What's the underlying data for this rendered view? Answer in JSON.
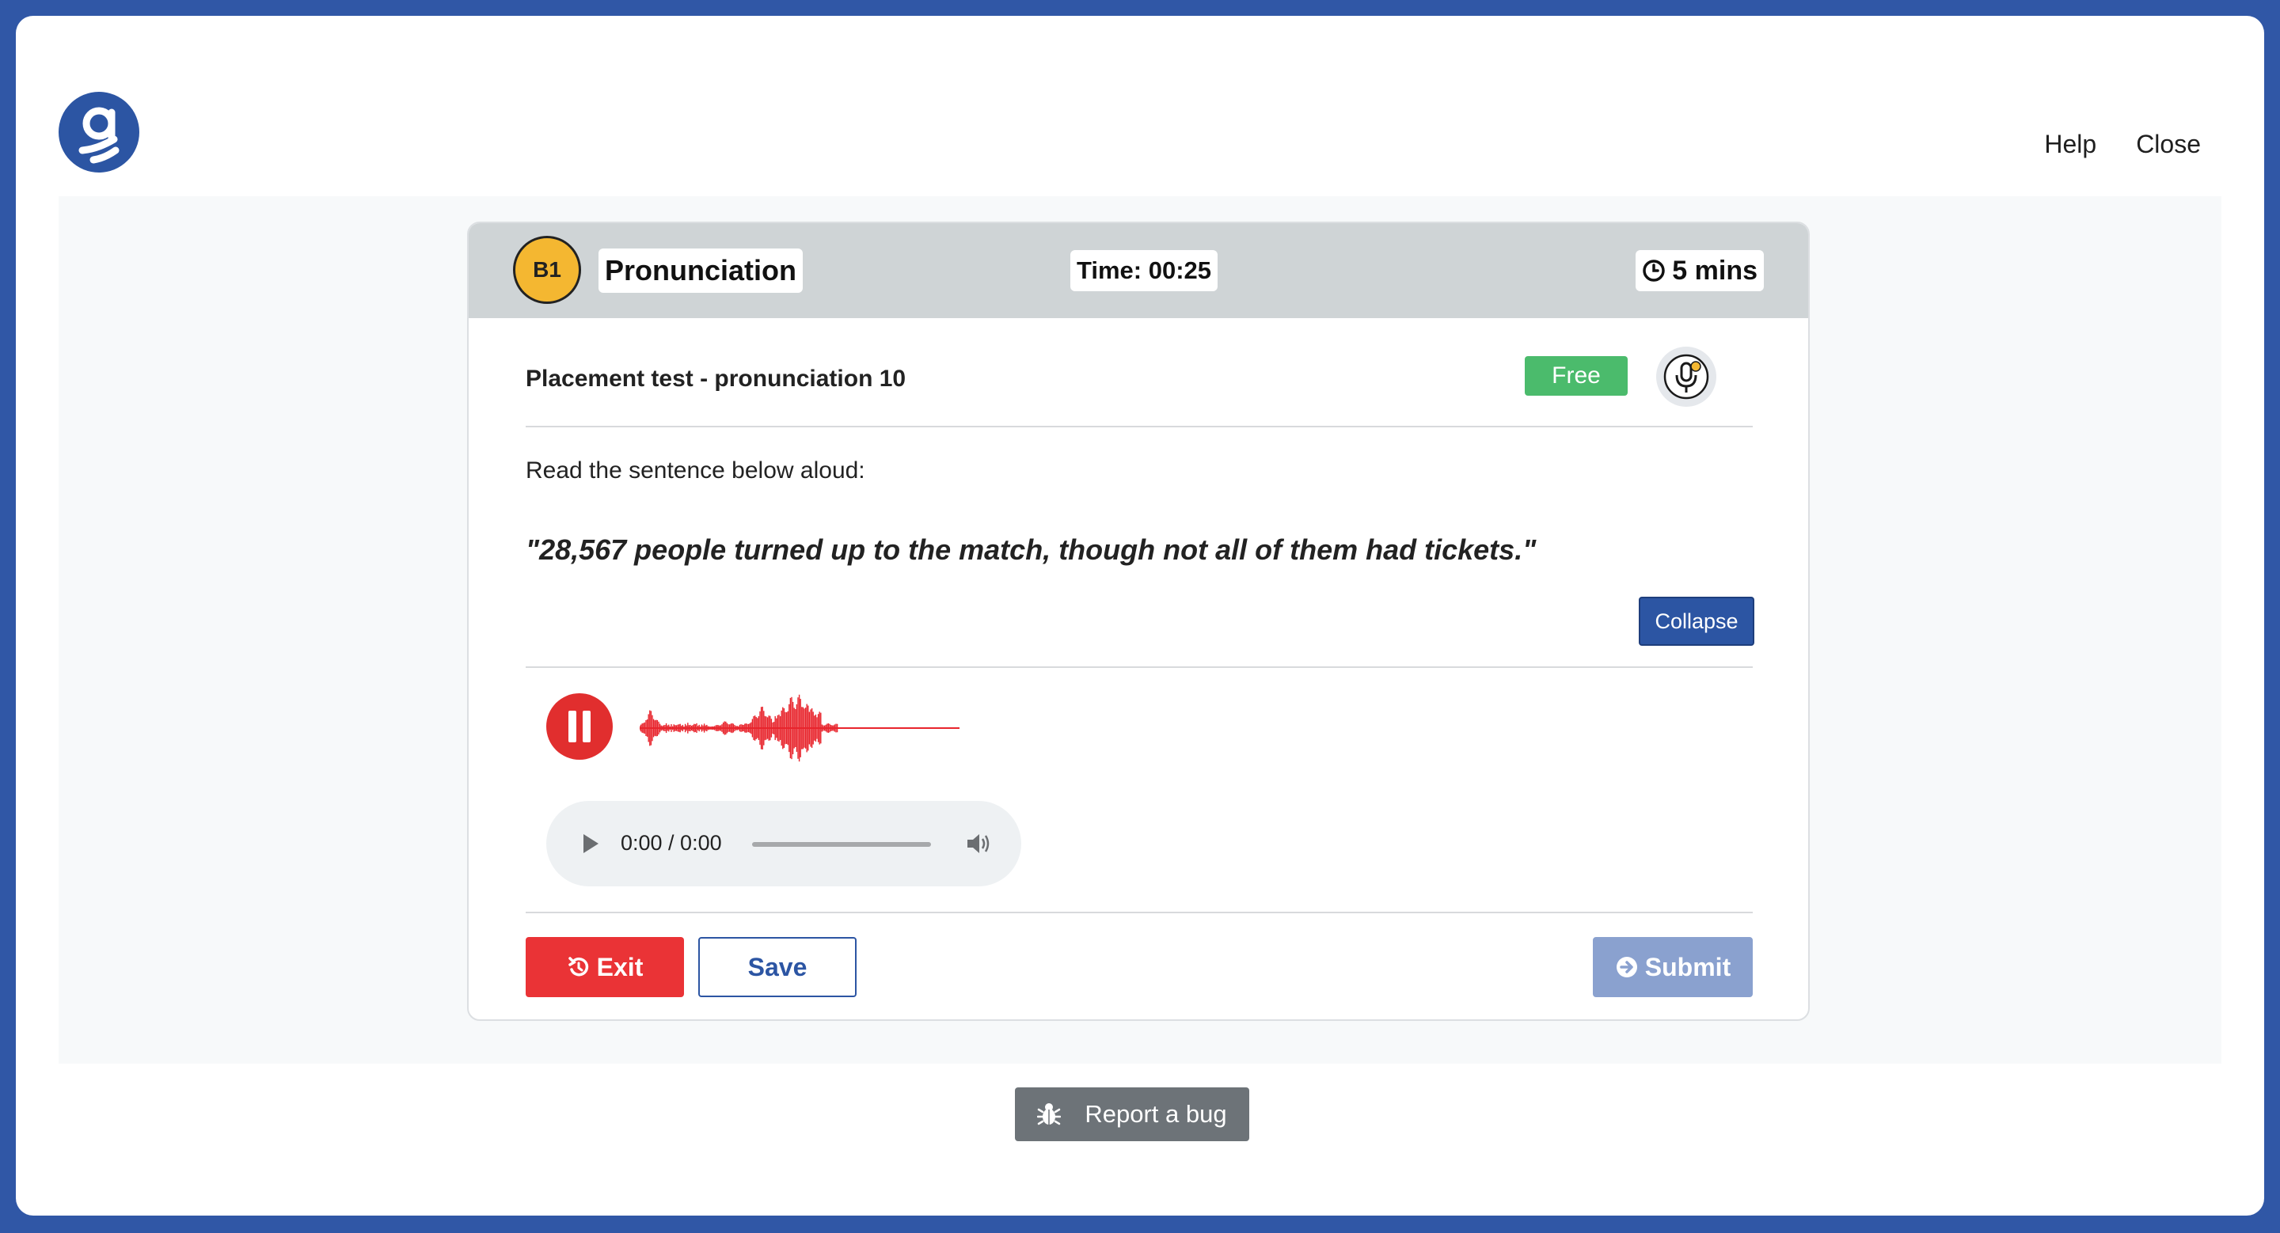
{
  "nav": {
    "help": "Help",
    "close": "Close"
  },
  "header": {
    "level": "B1",
    "skill": "Pronunciation",
    "timer": "Time: 00:25",
    "duration": "5 mins"
  },
  "test": {
    "title": "Placement test - pronunciation 10",
    "badge": "Free",
    "instruction": "Read the sentence below aloud:",
    "sentence": "\"28,567 people turned up to the match, though not all of them had tickets.\"",
    "collapse_label": "Collapse"
  },
  "player": {
    "time": "0:00 / 0:00"
  },
  "actions": {
    "exit": "Exit",
    "save": "Save",
    "submit": "Submit"
  },
  "footer": {
    "report_bug": "Report a bug"
  },
  "colors": {
    "brand": "#2c55a3",
    "level": "#f4b731",
    "free": "#4bbb6c",
    "danger": "#ea3336",
    "submit_disabled": "#8aa1cf",
    "waveform": "#e8252d"
  }
}
